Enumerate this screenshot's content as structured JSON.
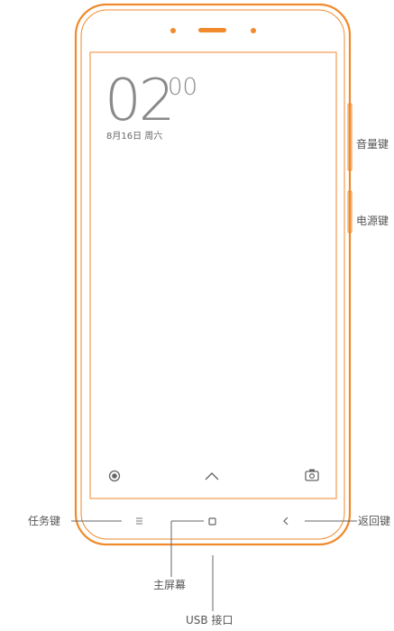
{
  "screen": {
    "clock_hour": "02",
    "clock_minute": "00",
    "date": "8月16日 周六"
  },
  "labels": {
    "volume_key": "音量键",
    "power_key": "电源键",
    "task_key": "任务键",
    "back_key": "返回键",
    "home_screen": "主屏幕",
    "usb_port": "USB 接口"
  },
  "icons": {
    "shutter": "record-circle-icon",
    "unlock": "chevron-up-icon",
    "camera": "camera-icon",
    "menu": "menu-icon",
    "home": "home-square-icon",
    "back": "back-chevron-icon"
  },
  "colors": {
    "phone_outline": "#f08a2c",
    "icon_gray": "#777777",
    "line_gray": "#666666"
  }
}
